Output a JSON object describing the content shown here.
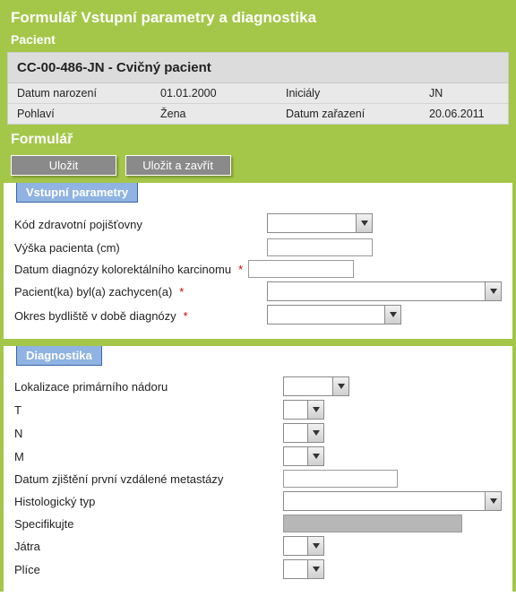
{
  "header": {
    "title": "Formulář Vstupní parametry a diagnostika",
    "patient_section": "Pacient",
    "form_section": "Formulář"
  },
  "patient": {
    "title": "CC-00-486-JN - Cvičný pacient",
    "rows": [
      {
        "l1": "Datum narození",
        "v1": "01.01.2000",
        "l2": "Iniciály",
        "v2": "JN"
      },
      {
        "l1": "Pohlaví",
        "v1": "Žena",
        "l2": "Datum zařazení",
        "v2": "20.06.2011"
      }
    ]
  },
  "buttons": {
    "save": "Uložit",
    "save_close": "Uložit a zavřít"
  },
  "sections": {
    "vstupni": "Vstupní parametry",
    "diagnostika": "Diagnostika"
  },
  "fields": {
    "kod_pojistovny": "Kód zdravotní pojišťovny",
    "vyska": "Výška pacienta (cm)",
    "datum_diag": "Datum diagnózy kolorektálního karcinomu",
    "zachycen": "Pacient(ka) byl(a) zachycen(a)",
    "okres": "Okres bydliště v době diagnózy",
    "lokalizace": "Lokalizace primárního nádoru",
    "t": "T",
    "n": "N",
    "m": "M",
    "datum_meta": "Datum zjištění první vzdálené metastázy",
    "hist_typ": "Histologický typ",
    "specifikujte": "Specifikujte",
    "jatra": "Játra",
    "plice": "Plíce"
  }
}
